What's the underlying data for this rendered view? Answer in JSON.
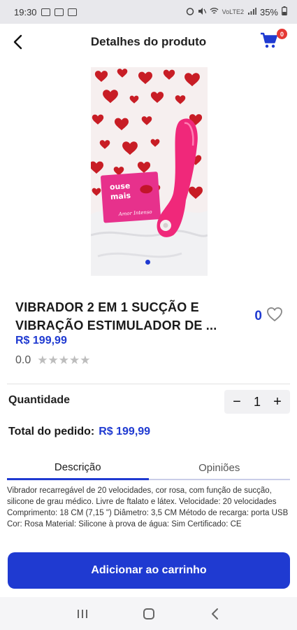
{
  "status_bar": {
    "time": "19:30",
    "battery": "35%",
    "net_label": "VoLTE2"
  },
  "app_bar": {
    "title": "Detalhes do produto",
    "cart_count": "0",
    "back_icon": "chevron-left-icon",
    "cart_icon": "shopping-cart-icon"
  },
  "product_image": {
    "box_text_line1": "ouse",
    "box_text_line2": "mais",
    "box_logo_text": "Amor Intenso"
  },
  "product": {
    "name": "VIBRADOR 2 EM 1 SUCÇÃO E VIBRAÇÃO ESTIMULADOR DE ...",
    "price": "R$ 199,99",
    "rating": "0.0",
    "stars": "★★★★★",
    "favorites_count": "0"
  },
  "quantity": {
    "label": "Quantidade",
    "value": "1",
    "decrement": "−",
    "increment": "+"
  },
  "total": {
    "label": "Total do pedido:",
    "value": "R$ 199,99"
  },
  "tabs": [
    {
      "label": "Descrição",
      "active": true
    },
    {
      "label": "Opiniões",
      "active": false
    }
  ],
  "description": "Vibrador recarregável de 20 velocidades, cor rosa, com função de sucção, silicone de grau médico. Livre de ftalato e látex. Velocidade: 20 velocidades Comprimento: 18 CM (7,15 \") Diâmetro: 3,5 CM Método de recarga: porta USB Cor: Rosa Material: Silicone à prova de água: Sim Certificado: CE",
  "add_to_cart_label": "Adicionar ao carrinho",
  "colors": {
    "accent": "#1f3ad1",
    "badge": "#e53935",
    "product_pink": "#f0287a"
  }
}
